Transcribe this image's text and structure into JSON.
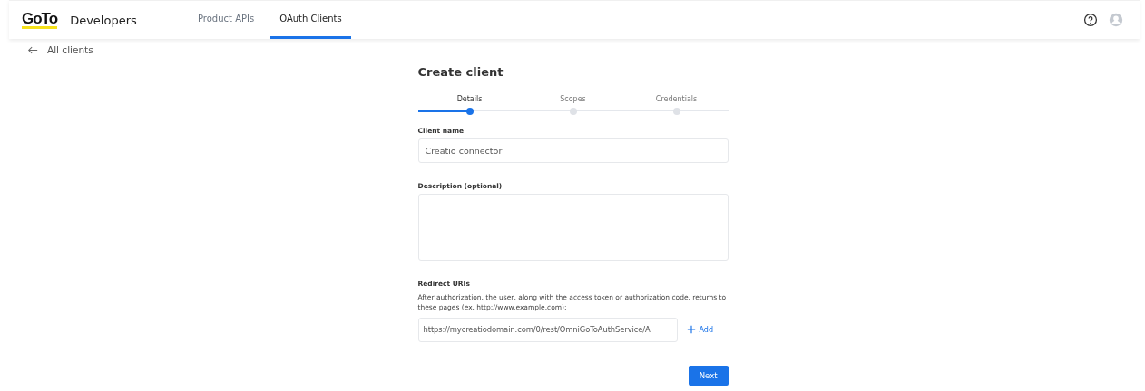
{
  "header": {
    "brand": "GoTo",
    "product": "Developers",
    "nav": [
      {
        "label": "Product APIs",
        "selected": false
      },
      {
        "label": "OAuth Clients",
        "selected": true
      }
    ]
  },
  "back_link": "All clients",
  "title": "Create client",
  "steps": [
    {
      "label": "Details",
      "selected": true
    },
    {
      "label": "Scopes",
      "selected": false
    },
    {
      "label": "Credentials",
      "selected": false
    }
  ],
  "client_name": {
    "label": "Client name",
    "value": "Creatio connector"
  },
  "description": {
    "label": "Description (optional)"
  },
  "redirect": {
    "label": "Redirect URIs",
    "help": "After authorization, the user, along with the access token or authorization code, returns to these pages (ex. http://www.example.com):",
    "value": "https://mycreatiodomain.com/0/rest/OmniGoToAuthService/A",
    "add": "Add"
  },
  "next_button": "Next"
}
